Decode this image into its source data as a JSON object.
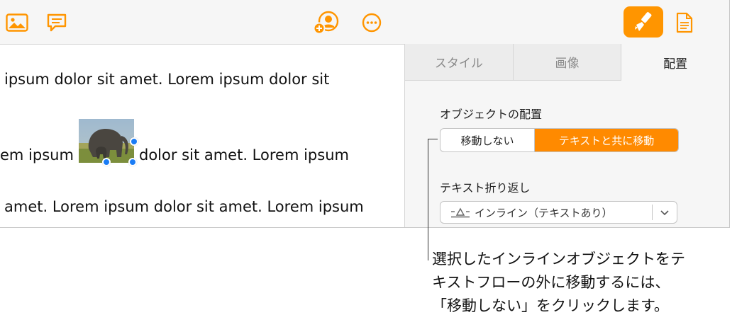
{
  "toolbar": {
    "icons": [
      "photo-icon",
      "comment-icon",
      "collaborate-icon",
      "more-icon",
      "format-brush-icon",
      "document-icon"
    ],
    "accent": "#ff9500"
  },
  "document": {
    "line1": "ipsum dolor sit amet.  Lorem ipsum dolor sit",
    "line2_left": "em ipsum",
    "line2_right": "dolor sit amet. Lorem ipsum",
    "line3": "amet. Lorem ipsum dolor sit amet. Lorem ipsum"
  },
  "inspector": {
    "tabs": [
      {
        "label": "スタイル",
        "active": false
      },
      {
        "label": "画像",
        "active": false
      },
      {
        "label": "配置",
        "active": true
      }
    ],
    "object_placement": {
      "label": "オブジェクトの配置",
      "options": [
        "移動しない",
        "テキストと共に移動"
      ],
      "selected": "テキストと共に移動"
    },
    "text_wrap": {
      "label": "テキスト折り返し",
      "value": "インライン（テキストあり）"
    }
  },
  "callout": {
    "lines": [
      "選択したインラインオブジェクトをテ",
      "キストフローの外に移動するには、",
      "「移動しない」をクリックします。"
    ]
  }
}
